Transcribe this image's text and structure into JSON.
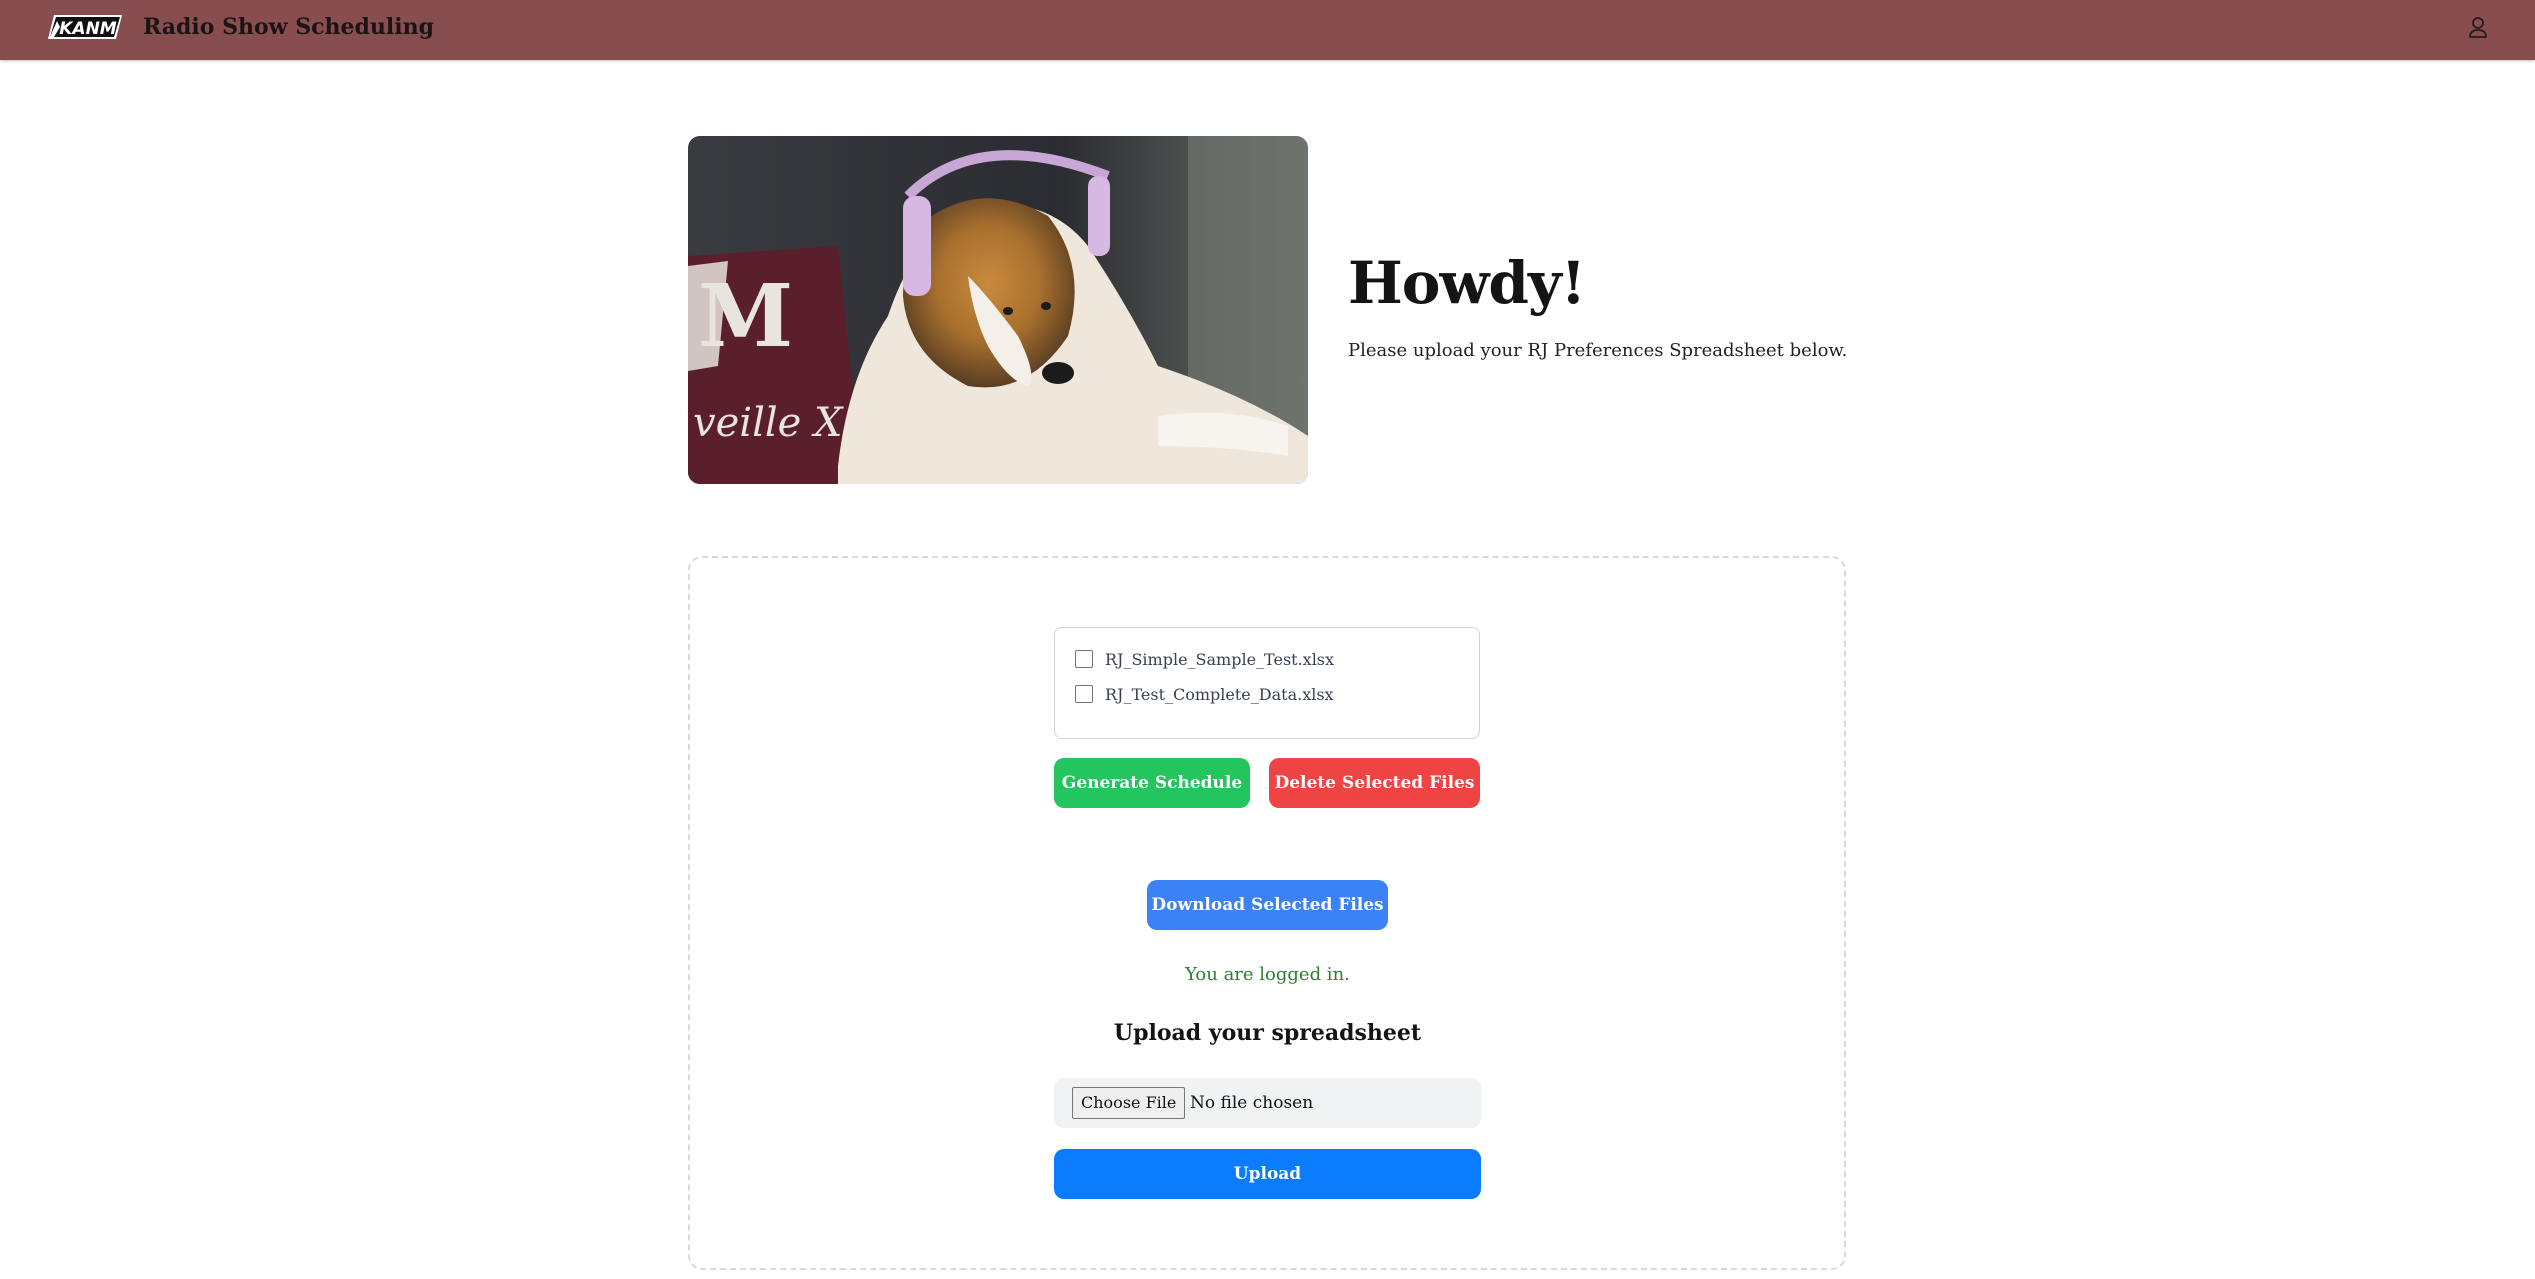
{
  "header": {
    "logo_text": "KANM",
    "title": "Radio Show Scheduling",
    "user_icon": "user-icon",
    "bar_color": "#874d4f"
  },
  "hero": {
    "image": "collie-with-headphones-photo",
    "image_text": [
      "M",
      "veille X"
    ],
    "title": "Howdy!",
    "subtitle": "Please upload your RJ Preferences Spreadsheet below."
  },
  "files": {
    "items": [
      {
        "name": "RJ_Simple_Sample_Test.xlsx",
        "checked": false
      },
      {
        "name": "RJ_Test_Complete_Data.xlsx",
        "checked": false
      }
    ]
  },
  "actions": {
    "generate_label": "Generate Schedule",
    "delete_label": "Delete Selected Files",
    "download_label": "Download Selected Files"
  },
  "status": {
    "logged_in": "You are logged in."
  },
  "upload": {
    "heading": "Upload your spreadsheet",
    "choose_label": "Choose File",
    "no_file": "No file chosen",
    "upload_label": "Upload"
  },
  "colors": {
    "green": "#22c55e",
    "red": "#ef4444",
    "blue": "#3b82f6",
    "upload_blue": "#0a7cff",
    "status_green": "#2f7d32"
  }
}
